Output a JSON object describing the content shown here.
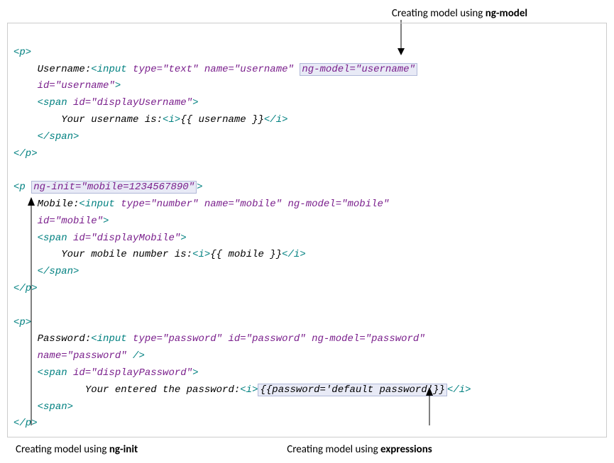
{
  "annotations": {
    "top": {
      "prefix": "Creating model using ",
      "bold": "ng-model"
    },
    "bottom_left": {
      "prefix": "Creating model using ",
      "bold": "ng-init"
    },
    "bottom_right": {
      "prefix": "Creating model using ",
      "bold": "expressions"
    }
  },
  "code": {
    "p_open": "<p>",
    "p_close": "</p>",
    "span_close": "</span>",
    "i_open": "<i>",
    "i_close": "</i>",
    "input_open": "<input",
    "span_open": "<span",
    "close": ">",
    "slash_close": " />",
    "p_open_sp": "<p ",
    "username_label": "Username:",
    "type_text": " type=\"text\"",
    "name_username": " name=\"username\"",
    "ngmodel_username": "ng-model=\"username\"",
    "id_username": "id=\"username\"",
    "id_display_username": " id=\"displayUsername\"",
    "your_username": "Your username is:",
    "expr_username": "{{ username }}",
    "nginit_mobile": "ng-init=\"mobile=1234567890\"",
    "mobile_label": "Mobile:",
    "type_number": " type=\"number\"",
    "name_mobile": " name=\"mobile\"",
    "ngmodel_mobile": " ng-model=\"mobile\"",
    "id_mobile": "id=\"mobile\"",
    "id_display_mobile": " id=\"displayMobile\"",
    "your_mobile": "Your mobile number is:",
    "expr_mobile": "{{ mobile }}",
    "password_label": "Password:",
    "type_password": " type=\"password\"",
    "id_password": " id=\"password\"",
    "ngmodel_password": " ng-model=\"password\"",
    "name_password": "name=\"password\"",
    "id_display_password": " id=\"displayPassword\"",
    "your_password": "Your entered the password:",
    "expr_password": "{{password='default password'}}",
    "span_unclosed": "<span>"
  }
}
